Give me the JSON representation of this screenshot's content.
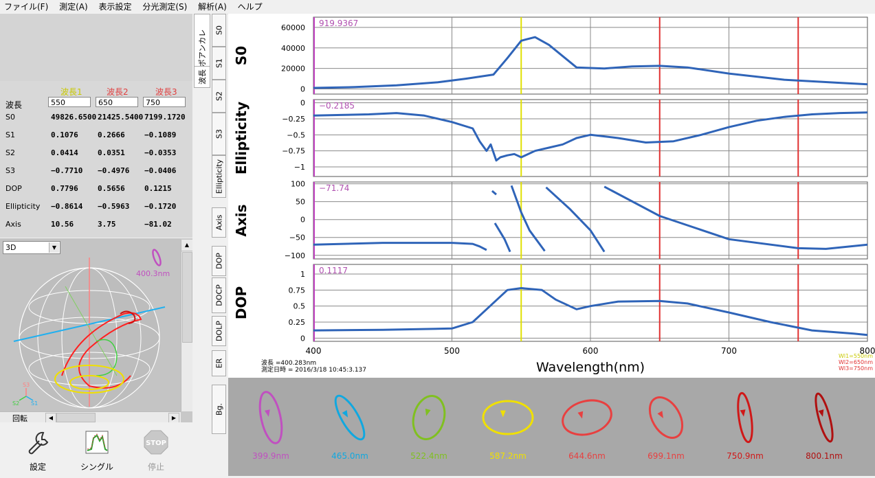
{
  "menu": [
    "ファイル(F)",
    "測定(A)",
    "表示設定",
    "分光測定(S)",
    "解析(A)",
    "ヘルプ"
  ],
  "table": {
    "headers": [
      "波長1",
      "波長2",
      "波長3"
    ],
    "header_colors": [
      "#c8c800",
      "#e04040",
      "#e04040"
    ],
    "wavelength_label": "波長",
    "wavelength_values": [
      "550",
      "650",
      "750"
    ],
    "rows": [
      {
        "label": "S0",
        "values": [
          "49826.6500",
          "21425.5400",
          "7199.1720"
        ]
      },
      {
        "label": "S1",
        "values": [
          "0.1076",
          "0.2666",
          "−0.1089"
        ]
      },
      {
        "label": "S2",
        "values": [
          "0.0414",
          "0.0351",
          "−0.0353"
        ]
      },
      {
        "label": "S3",
        "values": [
          "−0.7710",
          "−0.4976",
          "−0.0406"
        ]
      },
      {
        "label": "DOP",
        "values": [
          "0.7796",
          "0.5656",
          "0.1215"
        ]
      },
      {
        "label": "Ellipticity",
        "values": [
          "−0.8614",
          "−0.5963",
          "−0.1720"
        ]
      },
      {
        "label": "Axis",
        "values": [
          "10.56",
          "3.75",
          "−81.02"
        ]
      }
    ]
  },
  "sphere": {
    "mode": "3D",
    "wavelength_label": "400.3nm",
    "axis_labels": [
      "S3",
      "S2",
      "S1"
    ],
    "rotate_label": "回転"
  },
  "toolbar": {
    "settings": "設定",
    "single": "シングル",
    "stop": "停止",
    "stop_icon_text": "STOP"
  },
  "vtabs": {
    "top_main": [
      "ポアンカレ",
      "波長"
    ],
    "side": [
      "S0",
      "S1",
      "S2",
      "S3",
      "Ellipticity",
      "Axis",
      "DOP",
      "DOCP",
      "DOLP",
      "ER",
      "Bg."
    ]
  },
  "chart_data": {
    "type": "line",
    "xlabel": "Wavelength(nm)",
    "xlim": [
      400,
      800
    ],
    "x_ticks": [
      "400",
      "500",
      "600",
      "700",
      "800"
    ],
    "markers": [
      {
        "x": 550,
        "color": "#e0e000",
        "label": "Wl1=550nm"
      },
      {
        "x": 650,
        "color": "#e03030",
        "label": "Wl2=650nm"
      },
      {
        "x": 750,
        "color": "#e03030",
        "label": "Wl3=750nm"
      }
    ],
    "info": {
      "wavelength": "波長 =400.283nm",
      "datetime": "測定日時 = 2016/3/18 10:45:3.137"
    },
    "panels": [
      {
        "ylabel": "S0",
        "cursor_value": "919.9367",
        "ylim": [
          -5000,
          70000
        ],
        "y_ticks": [
          "0",
          "20000",
          "40000",
          "60000"
        ],
        "x": [
          400,
          430,
          460,
          490,
          510,
          530,
          540,
          550,
          560,
          570,
          590,
          610,
          630,
          650,
          670,
          700,
          740,
          780,
          800
        ],
        "y": [
          1000,
          1800,
          3500,
          6500,
          10000,
          14000,
          30000,
          47000,
          50500,
          43000,
          21000,
          20000,
          22000,
          22500,
          21000,
          15000,
          9000,
          6000,
          4500
        ]
      },
      {
        "ylabel": "Ellipticity",
        "cursor_value": "−0.2185",
        "ylim": [
          -1.15,
          0.05
        ],
        "y_ticks": [
          "0",
          "−0.25",
          "−0.5",
          "−0.75",
          "−1"
        ],
        "x": [
          400,
          420,
          440,
          460,
          480,
          500,
          515,
          520,
          525,
          528,
          532,
          535,
          540,
          545,
          550,
          560,
          570,
          580,
          590,
          600,
          620,
          640,
          660,
          680,
          700,
          720,
          740,
          760,
          780,
          800
        ],
        "y": [
          -0.2,
          -0.19,
          -0.18,
          -0.16,
          -0.2,
          -0.3,
          -0.4,
          -0.6,
          -0.75,
          -0.65,
          -0.9,
          -0.85,
          -0.82,
          -0.8,
          -0.85,
          -0.75,
          -0.7,
          -0.65,
          -0.55,
          -0.5,
          -0.55,
          -0.62,
          -0.6,
          -0.5,
          -0.38,
          -0.28,
          -0.22,
          -0.18,
          -0.16,
          -0.15
        ]
      },
      {
        "ylabel": "Axis",
        "cursor_value": "−71.74",
        "ylim": [
          -110,
          105
        ],
        "y_ticks": [
          "100",
          "50",
          "0",
          "−50",
          "−100"
        ],
        "segments": [
          {
            "x": [
              400,
              450,
              500,
              515,
              520,
              525
            ],
            "y": [
              -70,
              -65,
              -65,
              -68,
              -75,
              -85
            ]
          },
          {
            "x": [
              529,
              532
            ],
            "y": [
              80,
              70
            ]
          },
          {
            "x": [
              531,
              538,
              542
            ],
            "y": [
              -10,
              -55,
              -90
            ]
          },
          {
            "x": [
              543,
              550,
              556,
              567
            ],
            "y": [
              95,
              20,
              -30,
              -88
            ]
          },
          {
            "x": [
              568,
              585,
              600,
              610
            ],
            "y": [
              90,
              30,
              -30,
              -90
            ]
          },
          {
            "x": [
              610,
              650,
              700,
              750,
              770,
              800
            ],
            "y": [
              92,
              10,
              -55,
              -80,
              -82,
              -70
            ]
          }
        ]
      },
      {
        "ylabel": "DOP",
        "cursor_value": "0.1117",
        "ylim": [
          -0.05,
          1.15
        ],
        "y_ticks": [
          "1",
          "0.75",
          "0.5",
          "0.25",
          "0"
        ],
        "x": [
          400,
          450,
          500,
          515,
          525,
          540,
          550,
          565,
          575,
          590,
          600,
          620,
          650,
          670,
          700,
          730,
          760,
          790,
          800
        ],
        "y": [
          0.12,
          0.13,
          0.15,
          0.25,
          0.45,
          0.75,
          0.78,
          0.75,
          0.6,
          0.45,
          0.5,
          0.57,
          0.58,
          0.54,
          0.4,
          0.25,
          0.12,
          0.07,
          0.05
        ]
      }
    ]
  },
  "ellipses": [
    {
      "label": "399.9nm",
      "color": "#c050c0",
      "rx": 14,
      "ry": 38,
      "rot": -12
    },
    {
      "label": "465.0nm",
      "color": "#10a8e0",
      "rx": 12,
      "ry": 36,
      "rot": -30
    },
    {
      "label": "522.4nm",
      "color": "#80c020",
      "rx": 22,
      "ry": 32,
      "rot": 15
    },
    {
      "label": "587.2nm",
      "color": "#f0e000",
      "rx": 36,
      "ry": 24,
      "rot": 0
    },
    {
      "label": "644.6nm",
      "color": "#e84040",
      "rx": 36,
      "ry": 24,
      "rot": -15
    },
    {
      "label": "699.1nm",
      "color": "#e84040",
      "rx": 20,
      "ry": 32,
      "rot": -30
    },
    {
      "label": "750.9nm",
      "color": "#d01818",
      "rx": 9,
      "ry": 36,
      "rot": -8
    },
    {
      "label": "800.1nm",
      "color": "#b01010",
      "rx": 8,
      "ry": 36,
      "rot": -15
    }
  ]
}
